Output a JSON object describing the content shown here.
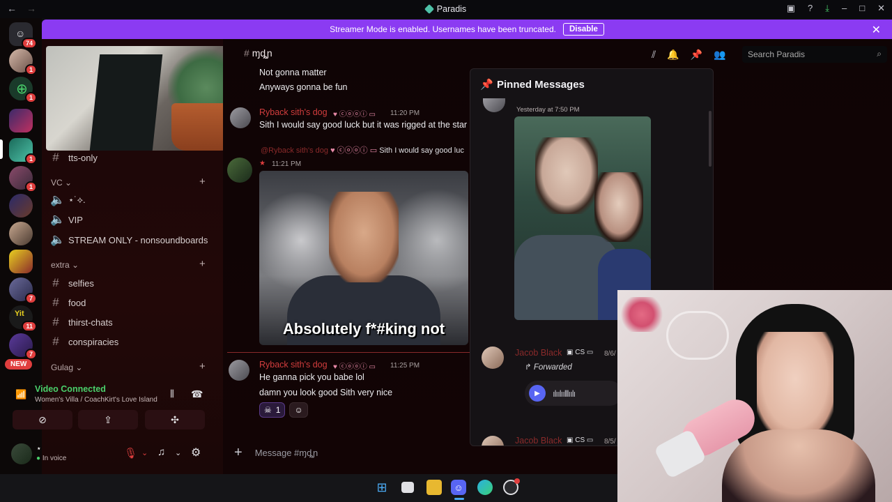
{
  "window": {
    "title": "Paradis",
    "back": "←",
    "forward": "→"
  },
  "titlebar_icons": [
    "inbox-icon",
    "help-icon",
    "download-icon",
    "minimize-icon",
    "maximize-icon",
    "close-icon"
  ],
  "banner": {
    "text": "Streamer Mode is enabled. Usernames have been truncated.",
    "button": "Disable",
    "close": "✕"
  },
  "servers": {
    "home_badge": "74",
    "badges": [
      "1",
      "1",
      "1",
      "1",
      "7",
      "11",
      "7"
    ],
    "new_label": "NEW"
  },
  "channels": [
    {
      "name": "tts-only",
      "type": "text"
    }
  ],
  "categories": [
    {
      "name": "VC",
      "channels": [
        {
          "name": "⋆˙⟡.",
          "type": "voice"
        },
        {
          "name": "VIP",
          "type": "voice"
        },
        {
          "name": "STREAM ONLY - nonsoundboards",
          "type": "voice"
        }
      ]
    },
    {
      "name": "extra",
      "channels": [
        {
          "name": "selfies",
          "type": "text"
        },
        {
          "name": "food",
          "type": "text"
        },
        {
          "name": "thirst-chats",
          "type": "text"
        },
        {
          "name": "conspiracies",
          "type": "text"
        }
      ]
    },
    {
      "name": "Gulag",
      "channels": []
    }
  ],
  "voice": {
    "title": "Video Connected",
    "subtitle": "Women's Villa / CoachKirt's Love Island"
  },
  "user": {
    "name": "⋆",
    "status": "In voice"
  },
  "header": {
    "channel": "ɱȡɲ",
    "search_placeholder": "Search Paradis"
  },
  "messages": {
    "m1": "Not gonna matter",
    "m2": "Anyways gonna be fun",
    "author1": "Ryback sith's dog",
    "time1": "11:20 PM",
    "text1": "Sith I would say good luck but it was rigged at the star",
    "reply_author": "@Ryback sith's dog",
    "reply_text": "Sith I would say good luc",
    "time2": "11:21 PM",
    "gif_caption": "Absolutely f*#king not",
    "author3": "Ryback sith's dog",
    "time3": "11:25 PM",
    "text3a": "He ganna pick you babe lol",
    "text3b": "damn you look good Sith very nice",
    "reaction_count": "1"
  },
  "pinned": {
    "title": "Pinned Messages",
    "time1": "Yesterday at 7:50 PM",
    "author2": "Jacob Black",
    "tag2": "CS",
    "date2": "8/6/",
    "forwarded": "Forwarded",
    "author3": "Jacob Black",
    "tag3": "CS",
    "date3": "8/5/"
  },
  "composer": {
    "placeholder": "Message #ɱȡɲ"
  },
  "colors": {
    "accent": "#8b3bf2",
    "author": "#d23d3d",
    "voice_green": "#4ad06b"
  }
}
